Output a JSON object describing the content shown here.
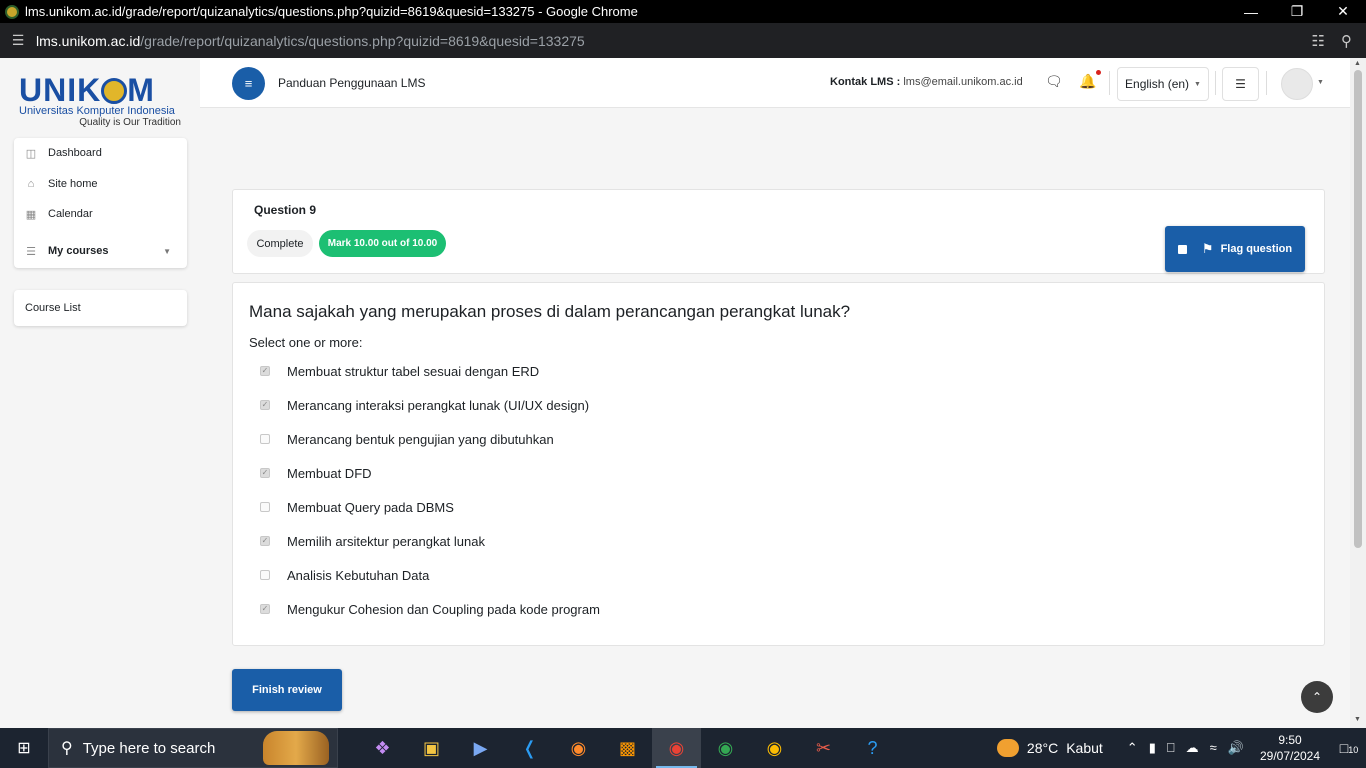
{
  "browser": {
    "title": "lms.unikom.ac.id/grade/report/quizanalytics/questions.php?quizid=8619&quesid=133275 - Google Chrome",
    "url_domain": "lms.unikom.ac.id",
    "url_path": "/grade/report/quizanalytics/questions.php?quizid=8619&quesid=133275"
  },
  "logo": {
    "wordmark_left": "UNIK",
    "wordmark_right": "M",
    "line1": "Universitas Komputer Indonesia",
    "line2": "Quality is Our Tradition"
  },
  "nav": {
    "items": [
      {
        "label": "Dashboard",
        "icon": "dashboard-icon"
      },
      {
        "label": "Site home",
        "icon": "home-icon"
      },
      {
        "label": "Calendar",
        "icon": "calendar-icon"
      },
      {
        "label": "My courses",
        "icon": "list-icon"
      }
    ],
    "course_list": "Course List"
  },
  "header": {
    "brand": "Panduan Penggunaan LMS",
    "contact_label": "Kontak LMS :",
    "contact_email": "lms@email.unikom.ac.id",
    "language": "English (en)"
  },
  "question": {
    "title": "Question 9",
    "state": "Complete",
    "mark": "Mark 10.00 out of 10.00",
    "flag_label": "Flag question",
    "text": "Mana sajakah yang merupakan proses di dalam perancangan perangkat lunak?",
    "prompt": "Select one or more:",
    "options": [
      {
        "label": "Membuat struktur tabel sesuai dengan ERD",
        "checked": true
      },
      {
        "label": "Merancang interaksi perangkat lunak (UI/UX design)",
        "checked": true
      },
      {
        "label": "Merancang bentuk pengujian yang dibutuhkan",
        "checked": false
      },
      {
        "label": "Membuat DFD",
        "checked": true
      },
      {
        "label": "Membuat Query pada DBMS",
        "checked": false
      },
      {
        "label": "Memilih arsitektur perangkat lunak",
        "checked": true
      },
      {
        "label": "Analisis Kebutuhan Data",
        "checked": false
      },
      {
        "label": "Mengukur Cohesion dan Coupling pada kode program",
        "checked": true
      }
    ]
  },
  "finish_label": "Finish review",
  "taskbar": {
    "search_placeholder": "Type here to search",
    "weather_temp": "28°C",
    "weather_desc": "Kabut",
    "time": "9:50",
    "date": "29/07/2024",
    "notifications": "10"
  },
  "colors": {
    "primary": "#1a5ea8",
    "success": "#1cbf73"
  }
}
